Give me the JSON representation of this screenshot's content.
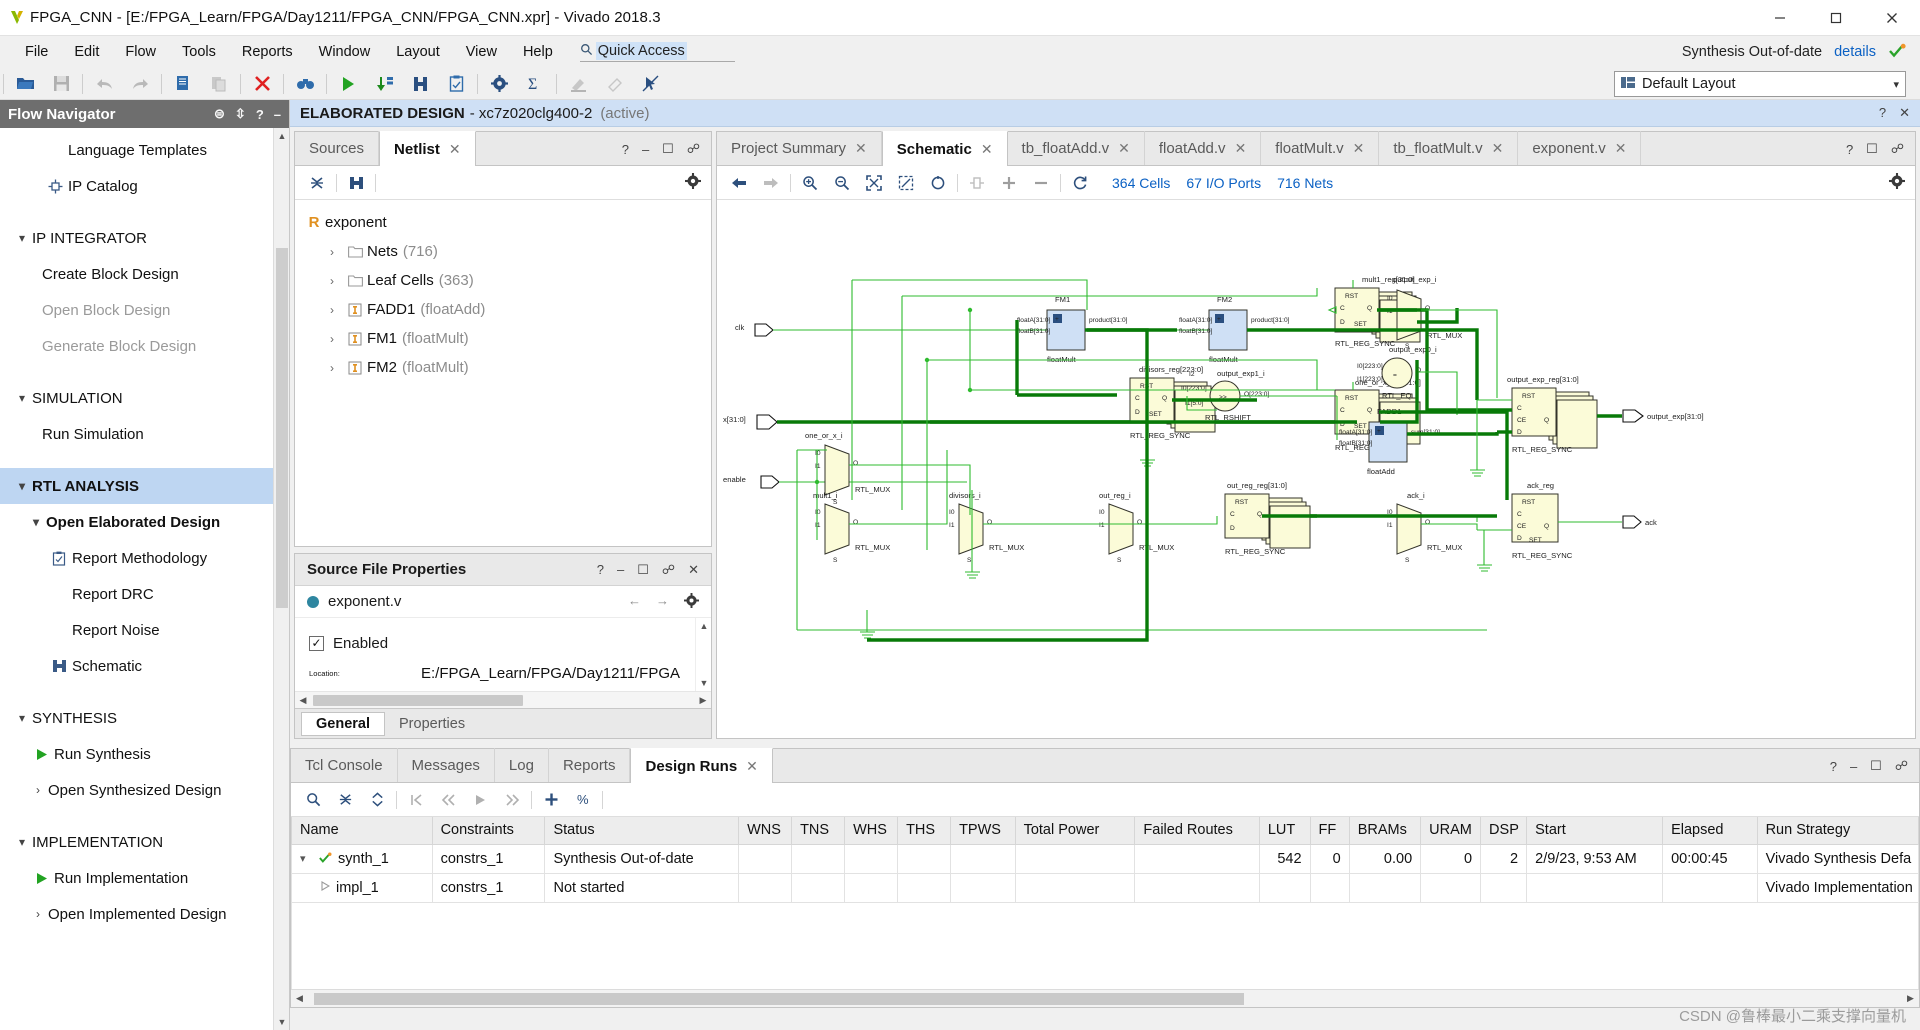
{
  "window": {
    "title": "FPGA_CNN - [E:/FPGA_Learn/FPGA/Day1211/FPGA_CNN/FPGA_CNN.xpr] - Vivado 2018.3",
    "minimize": "—",
    "maximize": "❐",
    "close": "✕"
  },
  "menu": {
    "items": [
      "File",
      "Edit",
      "Flow",
      "Tools",
      "Reports",
      "Window",
      "Layout",
      "View",
      "Help"
    ],
    "quick_access_placeholder": "Quick Access",
    "quick_access_value": "Quick Access",
    "status_label": "Synthesis Out-of-date",
    "status_details": "details",
    "layout_value": "Default Layout"
  },
  "flow_navigator": {
    "title": "Flow Navigator",
    "items": [
      {
        "label": "Language Templates",
        "indent": 1,
        "icon": "",
        "state": "normal"
      },
      {
        "label": "IP Catalog",
        "indent": 1,
        "icon": "ip-catalog-icon",
        "state": "normal"
      },
      {
        "label": "IP INTEGRATOR",
        "indent": 0,
        "icon": "chevron-down-icon",
        "state": "section"
      },
      {
        "label": "Create Block Design",
        "indent": 1,
        "icon": "",
        "state": "normal"
      },
      {
        "label": "Open Block Design",
        "indent": 1,
        "icon": "",
        "state": "dim"
      },
      {
        "label": "Generate Block Design",
        "indent": 1,
        "icon": "",
        "state": "dim"
      },
      {
        "label": "SIMULATION",
        "indent": 0,
        "icon": "chevron-down-icon",
        "state": "section"
      },
      {
        "label": "Run Simulation",
        "indent": 1,
        "icon": "",
        "state": "normal"
      },
      {
        "label": "RTL ANALYSIS",
        "indent": 0,
        "icon": "chevron-down-icon",
        "state": "selected"
      },
      {
        "label": "Open Elaborated Design",
        "indent": 1,
        "icon": "chevron-down-icon",
        "state": "bold"
      },
      {
        "label": "Report Methodology",
        "indent": 2,
        "icon": "clipboard-check-icon",
        "state": "normal"
      },
      {
        "label": "Report DRC",
        "indent": 2,
        "icon": "",
        "state": "normal"
      },
      {
        "label": "Report Noise",
        "indent": 2,
        "icon": "",
        "state": "normal"
      },
      {
        "label": "Schematic",
        "indent": 2,
        "icon": "schematic-icon",
        "state": "normal"
      },
      {
        "label": "SYNTHESIS",
        "indent": 0,
        "icon": "chevron-down-icon",
        "state": "section"
      },
      {
        "label": "Run Synthesis",
        "indent": 1,
        "icon": "play-icon",
        "state": "normal"
      },
      {
        "label": "Open Synthesized Design",
        "indent": 1,
        "icon": "chevron-right-icon",
        "state": "normal"
      },
      {
        "label": "IMPLEMENTATION",
        "indent": 0,
        "icon": "chevron-down-icon",
        "state": "section"
      },
      {
        "label": "Run Implementation",
        "indent": 1,
        "icon": "play-icon",
        "state": "normal"
      },
      {
        "label": "Open Implemented Design",
        "indent": 1,
        "icon": "chevron-right-icon",
        "state": "normal"
      }
    ]
  },
  "elaborated_header": {
    "title": "ELABORATED DESIGN",
    "device": "- xc7z020clg400-2",
    "active": "(active)"
  },
  "netlist_panel": {
    "tabs": [
      {
        "label": "Sources",
        "active": false,
        "closable": false
      },
      {
        "label": "Netlist",
        "active": true,
        "closable": true
      }
    ],
    "root": {
      "badge": "R",
      "label": "exponent"
    },
    "nodes": [
      {
        "label": "Nets",
        "count": "(716)",
        "icon": "folder-icon"
      },
      {
        "label": "Leaf Cells",
        "count": "(363)",
        "icon": "folder-icon"
      },
      {
        "label": "FADD1",
        "count": "(floatAdd)",
        "icon": "instance-icon"
      },
      {
        "label": "FM1",
        "count": "(floatMult)",
        "icon": "instance-icon"
      },
      {
        "label": "FM2",
        "count": "(floatMult)",
        "icon": "instance-icon"
      }
    ]
  },
  "source_properties": {
    "title": "Source File Properties",
    "file_name": "exponent.v",
    "enabled_label": "Enabled",
    "enabled_checked": true,
    "location_label": "Location:",
    "location_value": "E:/FPGA_Learn/FPGA/Day1211/FPGA",
    "tabs": [
      {
        "label": "General",
        "active": true
      },
      {
        "label": "Properties",
        "active": false
      }
    ]
  },
  "schematic_panel": {
    "tabs": [
      {
        "label": "Project Summary",
        "active": false,
        "closable": true
      },
      {
        "label": "Schematic",
        "active": true,
        "closable": true
      },
      {
        "label": "tb_floatAdd.v",
        "active": false,
        "closable": true
      },
      {
        "label": "floatAdd.v",
        "active": false,
        "closable": true
      },
      {
        "label": "floatMult.v",
        "active": false,
        "closable": true
      },
      {
        "label": "tb_floatMult.v",
        "active": false,
        "closable": true
      },
      {
        "label": "exponent.v",
        "active": false,
        "closable": true
      }
    ],
    "stats": [
      "364 Cells",
      "67 I/O Ports",
      "716 Nets"
    ],
    "ports_in": [
      "clk",
      "x[31:0]",
      "enable"
    ],
    "ports_out": [
      "output_exp[31:0]",
      "ack"
    ],
    "blocks": [
      {
        "name": "mult1_reg[31:0]",
        "type": "RTL_REG_SYNC"
      },
      {
        "name": "one_or_x_reg[31:0]",
        "type": "RTL_REG_SYNC"
      },
      {
        "name": "divisors_reg[223:0]",
        "type": "RTL_REG_SYNC"
      },
      {
        "name": "out_reg_reg[31:0]",
        "type": "RTL_REG_SYNC"
      },
      {
        "name": "output_exp_reg[31:0]",
        "type": "RTL_REG_SYNC"
      },
      {
        "name": "ack_reg",
        "type": "RTL_REG_SYNC"
      },
      {
        "name": "one_or_x_i",
        "type": "RTL_MUX"
      },
      {
        "name": "mult1_i",
        "type": "RTL_MUX"
      },
      {
        "name": "divisors_i",
        "type": "RTL_MUX"
      },
      {
        "name": "out_reg_i",
        "type": "RTL_MUX"
      },
      {
        "name": "output_exp_i",
        "type": "RTL_MUX"
      },
      {
        "name": "ack_i",
        "type": "RTL_MUX"
      },
      {
        "name": "output_exp1_i",
        "type": "RTL_RSHIFT"
      },
      {
        "name": "output_exp0_i",
        "type": "RTL_EQ"
      },
      {
        "name": "FM1",
        "type": "floatMult"
      },
      {
        "name": "FM2",
        "type": "floatMult"
      },
      {
        "name": "FADD1",
        "type": "floatAdd"
      }
    ]
  },
  "console": {
    "tabs": [
      {
        "label": "Tcl Console",
        "active": false,
        "closable": false
      },
      {
        "label": "Messages",
        "active": false,
        "closable": false
      },
      {
        "label": "Log",
        "active": false,
        "closable": false
      },
      {
        "label": "Reports",
        "active": false,
        "closable": false
      },
      {
        "label": "Design Runs",
        "active": true,
        "closable": true
      }
    ],
    "columns": [
      "Name",
      "Constraints",
      "Status",
      "WNS",
      "TNS",
      "WHS",
      "THS",
      "TPWS",
      "Total Power",
      "Failed Routes",
      "LUT",
      "FF",
      "BRAMs",
      "URAM",
      "DSP",
      "Start",
      "Elapsed",
      "Run Strategy"
    ],
    "rows": [
      {
        "name": "synth_1",
        "indent": 0,
        "icon": "check-icon",
        "chevron": "⌄",
        "constraints": "constrs_1",
        "status": "Synthesis Out-of-date",
        "wns": "",
        "tns": "",
        "whs": "",
        "ths": "",
        "tpws": "",
        "total_power": "",
        "failed_routes": "",
        "lut": "542",
        "ff": "0",
        "brams": "0.00",
        "uram": "0",
        "dsp": "2",
        "start": "2/9/23, 9:53 AM",
        "elapsed": "00:00:45",
        "run_strategy": "Vivado Synthesis Defa"
      },
      {
        "name": "impl_1",
        "indent": 1,
        "icon": "play-icon",
        "chevron": "",
        "constraints": "constrs_1",
        "status": "Not started",
        "wns": "",
        "tns": "",
        "whs": "",
        "ths": "",
        "tpws": "",
        "total_power": "",
        "failed_routes": "",
        "lut": "",
        "ff": "",
        "brams": "",
        "uram": "",
        "dsp": "",
        "start": "",
        "elapsed": "",
        "run_strategy": "Vivado Implementation"
      }
    ]
  },
  "watermark": {
    "text": "CSDN @鲁棒最小二乘支撑向量机"
  }
}
